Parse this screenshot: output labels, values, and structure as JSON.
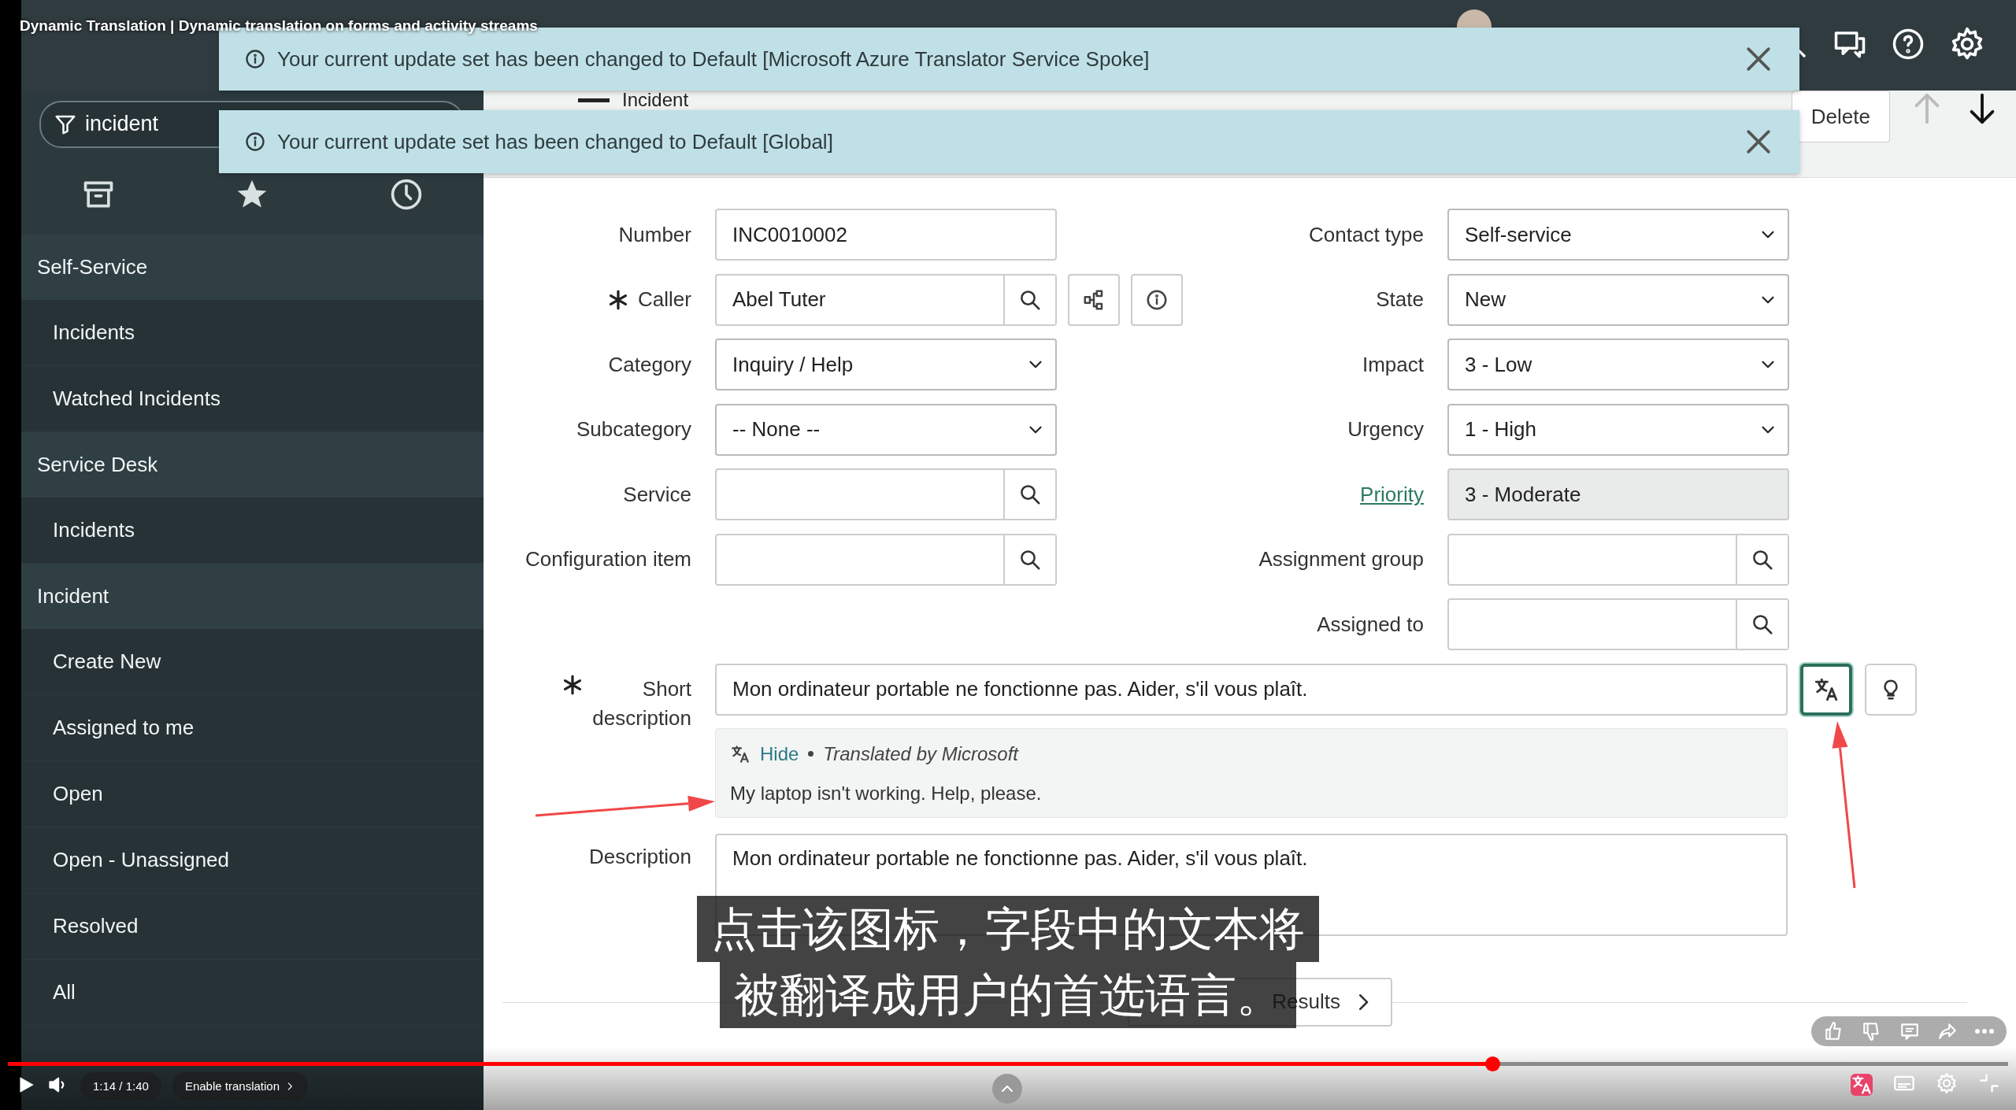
{
  "video": {
    "title": "Dynamic Translation | Dynamic translation on forms and activity streams",
    "subtitle_lines": [
      "点击该图标，字段中的文本将",
      "被翻译成用户的首选语言。"
    ],
    "progress": {
      "level": 0.742
    },
    "time": "1:14 / 1:40",
    "translation_button": "Enable translation"
  },
  "notifications": [
    {
      "message": "Your current update set has been changed to Default [Microsoft Azure Translator Service Spoke]"
    },
    {
      "message": "Your current update set has been changed to Default [Global]"
    }
  ],
  "sidebar": {
    "filter": "incident",
    "sections": [
      {
        "title": "Self-Service",
        "items": [
          "Incidents",
          "Watched Incidents"
        ]
      },
      {
        "title": "Service Desk",
        "items": [
          "Incidents"
        ]
      },
      {
        "title": "Incident",
        "items": [
          "Create New",
          "Assigned to me",
          "Open",
          "Open - Unassigned",
          "Resolved",
          "All"
        ]
      }
    ]
  },
  "form_header": {
    "title": "Incident",
    "buttons": [
      "Delete"
    ]
  },
  "form": {
    "left": [
      {
        "label": "Number",
        "kind": "text",
        "value": "INC0010002"
      },
      {
        "label": "Caller",
        "kind": "reference",
        "required": true,
        "value": "Abel Tuter",
        "actions": true
      },
      {
        "label": "Category",
        "kind": "select",
        "value": "Inquiry / Help"
      },
      {
        "label": "Subcategory",
        "kind": "select",
        "value": "-- None --"
      },
      {
        "label": "Service",
        "kind": "reference"
      },
      {
        "label": "Configuration item",
        "kind": "reference"
      }
    ],
    "right": [
      {
        "label": "Contact type",
        "kind": "select",
        "value": "Self-service"
      },
      {
        "label": "State",
        "kind": "select",
        "value": "New"
      },
      {
        "label": "Impact",
        "kind": "select",
        "value": "3 - Low"
      },
      {
        "label": "Urgency",
        "kind": "select",
        "value": "1 - High"
      },
      {
        "label": "Priority",
        "kind": "readonly",
        "link": true,
        "value": "3 - Moderate"
      },
      {
        "label": "Assignment group",
        "kind": "reference"
      },
      {
        "label": "Assigned to",
        "kind": "reference"
      }
    ],
    "short_description": {
      "label_lines": [
        "Short",
        "description"
      ],
      "required": true,
      "value": "Mon ordinateur portable ne fonctionne pas. Aider, s'il vous plaît.",
      "translate_active": true,
      "translation": {
        "action": "Hide",
        "source": "Translated by Microsoft",
        "text": "My laptop isn't working. Help, please."
      }
    },
    "description": {
      "label": "Description",
      "value": "Mon ordinateur portable ne fonctionne pas. Aider, s'il vous plaît."
    },
    "results_button": "Results"
  }
}
